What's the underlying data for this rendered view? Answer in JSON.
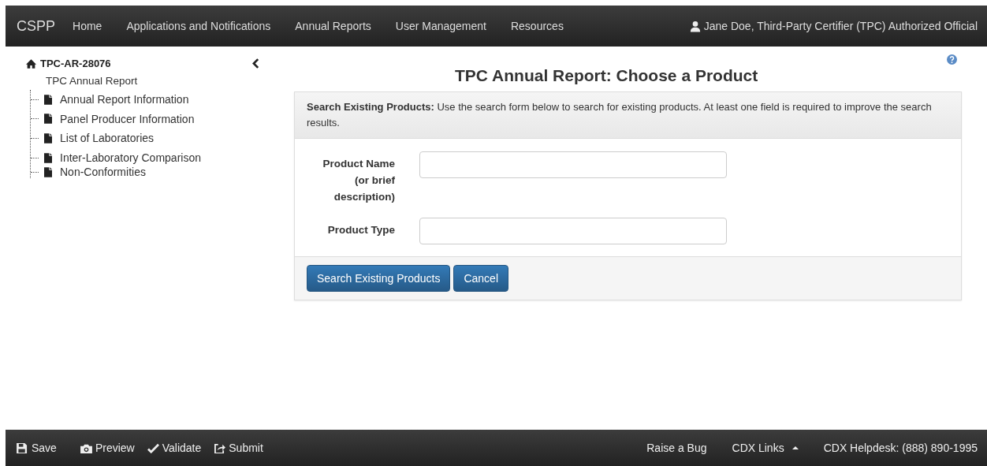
{
  "navbar": {
    "brand": "CSPP",
    "items": [
      "Home",
      "Applications and Notifications",
      "Annual Reports",
      "User Management",
      "Resources"
    ],
    "user": "Jane Doe, Third-Party Certifier (TPC) Authorized Official"
  },
  "sidebar": {
    "title": "TPC-AR-28076",
    "subtitle": "TPC Annual Report",
    "items": [
      "Annual Report Information",
      "Panel Producer Information",
      "List of Laboratories",
      "Inter-Laboratory Comparison",
      "Non-Conformities"
    ]
  },
  "page": {
    "title": "TPC Annual Report: Choose a Product",
    "panel": {
      "help": "**Search Existing Products:** Use the search form below to search for existing products. At least one field is required to improve the search results.",
      "fields": [
        {
          "label": "Product Name (or brief description)"
        },
        {
          "label": "Product Type"
        }
      ],
      "buttons": [
        "Search Existing Products",
        "Cancel"
      ]
    }
  },
  "footer": {
    "left": [
      {
        "kind": "save",
        "label": "Save"
      },
      {
        "kind": "preview",
        "label": "Preview"
      },
      {
        "kind": "validate",
        "label": "Validate"
      },
      {
        "kind": "submit",
        "label": "Submit"
      }
    ],
    "right": [
      {
        "kind": "link",
        "label": "Raise a Bug"
      },
      {
        "kind": "dropdown",
        "label": "CDX Links"
      },
      {
        "kind": "text",
        "label": "CDX Helpdesk: (888) 890-1995"
      }
    ]
  }
}
